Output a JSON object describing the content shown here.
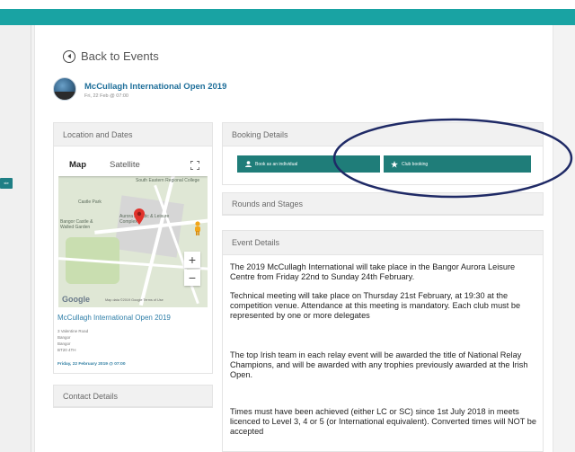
{
  "nav": {
    "back_label": "Back to Events",
    "side_tab_label": "ste"
  },
  "event": {
    "title": "McCullagh International Open 2019",
    "date": "Fri, 22 Feb @ 07:00"
  },
  "location": {
    "heading": "Location and Dates",
    "map": {
      "tab_map": "Map",
      "tab_satellite": "Satellite",
      "zoom_in": "+",
      "zoom_out": "−",
      "google_logo": "Google",
      "attribution": "Map data ©2019 Google  Terms of Use",
      "labels": [
        "South Eastern Regional College",
        "Castle Park",
        "Aurora Aquatic & Leisure Complex",
        "Bangor Castle & Walled Garden"
      ]
    },
    "venue_name": "McCullagh International Open 2019",
    "address_lines": [
      "3 Valentine Road",
      "Bangor",
      "Bangor",
      "BT20 4TH"
    ],
    "date_line": "Friday, 22 February 2019 @ 07:00"
  },
  "contact": {
    "heading": "Contact Details"
  },
  "booking": {
    "heading": "Booking Details",
    "individual_label": "Book as an individual",
    "club_label": "Club booking"
  },
  "rounds": {
    "heading": "Rounds and Stages"
  },
  "details": {
    "heading": "Event Details",
    "paragraphs": [
      "The 2019 McCullagh International will take place in the Bangor Aurora Leisure Centre from Friday 22nd to Sunday 24th February.",
      "Technical meeting will take place on Thursday 21st February, at 19:30 at the competition venue. Attendance at this meeting is mandatory. Each club must be represented by one or more delegates",
      "The top Irish team in each relay event will be awarded the title of National Relay Champions, and will be awarded with any trophies previously awarded at the Irish Open.",
      "Times must have been achieved (either LC or SC) since 1st July 2018 in meets licenced to Level 3, 4 or 5 (or International equivalent). Converted times will NOT be accepted"
    ]
  },
  "colors": {
    "header_teal": "#19a3a3",
    "button_teal": "#1f7d79",
    "link_blue": "#2e7ea8",
    "annotation_navy": "#1f2a66",
    "map_pin": "#e0322c"
  },
  "icons": [
    "back-circle-icon",
    "fullscreen-icon",
    "map-pin-icon",
    "pegman-icon",
    "user-icon",
    "star-icon"
  ]
}
